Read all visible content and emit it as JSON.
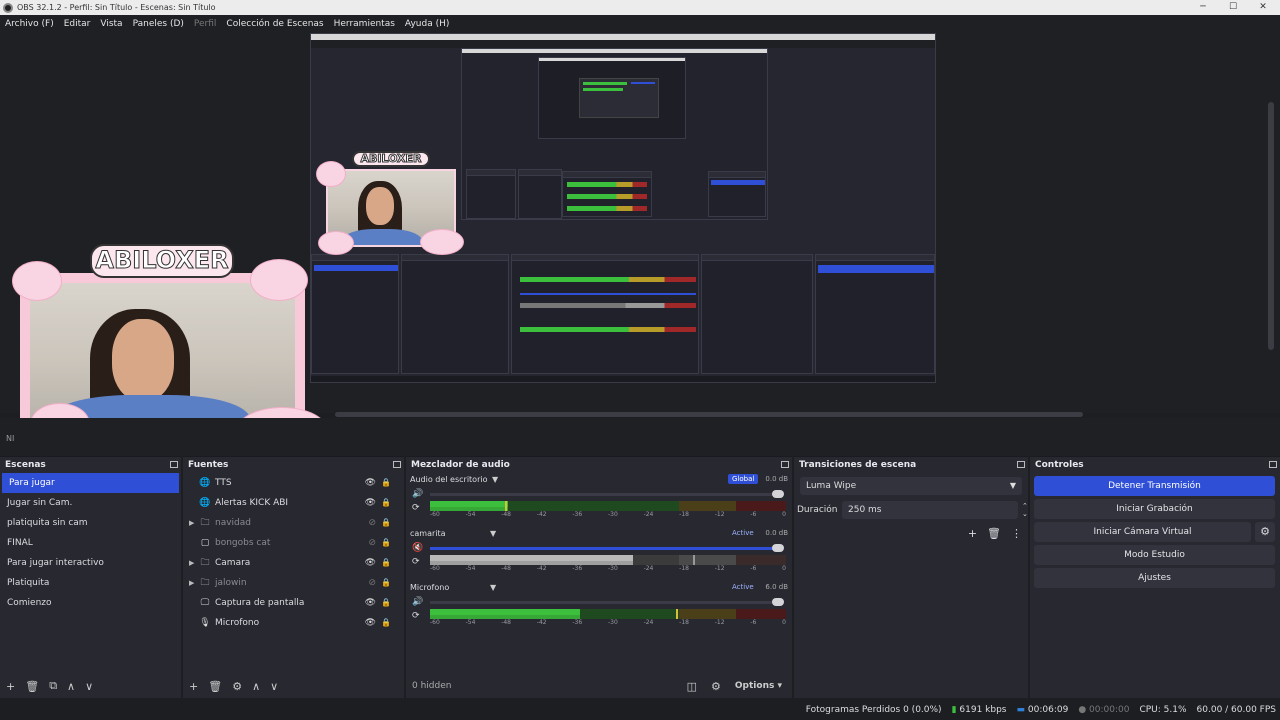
{
  "window": {
    "title": "OBS 32.1.2 - Perfil: Sin Título - Escenas: Sin Título",
    "minimize": "─",
    "maximize": "☐",
    "close": "✕"
  },
  "menu": [
    {
      "label": "Archivo (F)"
    },
    {
      "label": "Editar"
    },
    {
      "label": "Vista"
    },
    {
      "label": "Paneles (D)"
    },
    {
      "label": "Perfil",
      "disabled": true
    },
    {
      "label": "Colección de Escenas"
    },
    {
      "label": "Herramientas"
    },
    {
      "label": "Ayuda (H)"
    }
  ],
  "preview": {
    "overlay_name": "ABILOXER",
    "strip_text": "NI"
  },
  "scenes": {
    "title": "Escenas",
    "items": [
      "Para jugar",
      "Jugar sin Cam.",
      "platiquita sin cam",
      "FINAL",
      "Para jugar interactivo",
      "Platiquita",
      "Comienzo"
    ],
    "selected_index": 0,
    "footer": [
      "+",
      "🗑",
      "⧉",
      "∧",
      "∨"
    ]
  },
  "sources": {
    "title": "Fuentes",
    "items": [
      {
        "name": "TTS",
        "icon": "browser-icon",
        "glyph": "🌐",
        "group": false,
        "visible": true,
        "dim": false
      },
      {
        "name": "Alertas KICK ABI",
        "icon": "browser-icon",
        "glyph": "🌐",
        "group": false,
        "visible": true,
        "dim": false
      },
      {
        "name": "navidad",
        "icon": "folder-icon",
        "glyph": "🗀",
        "group": true,
        "visible": false,
        "dim": true
      },
      {
        "name": "bongobs cat",
        "icon": "image-icon",
        "glyph": "▢",
        "group": false,
        "visible": false,
        "dim": true
      },
      {
        "name": "Camara",
        "icon": "folder-icon",
        "glyph": "🗀",
        "group": true,
        "visible": true,
        "dim": false
      },
      {
        "name": "jalowin",
        "icon": "folder-icon",
        "glyph": "🗀",
        "group": true,
        "visible": false,
        "dim": true
      },
      {
        "name": "Captura de pantalla",
        "icon": "monitor-icon",
        "glyph": "🖵",
        "group": false,
        "visible": true,
        "dim": false
      },
      {
        "name": "Microfono",
        "icon": "microphone-icon",
        "glyph": "🎙",
        "group": false,
        "visible": true,
        "dim": false
      }
    ],
    "footer": [
      "+",
      "🗑",
      "⚙",
      "∧",
      "∨"
    ]
  },
  "mixer": {
    "title": "Mezclador de audio",
    "channels": [
      {
        "name": "Audio del escritorio",
        "tag": "Global",
        "db": "0.0 dB",
        "muted": false,
        "level": 0.22,
        "peak": 0.21,
        "slider": 1.0
      },
      {
        "name": "camarita",
        "tag": "Active",
        "db": "0.0 dB",
        "muted": true,
        "level": 0.57,
        "peak": 0.74,
        "slider": 1.0
      },
      {
        "name": "Microfono",
        "tag": "Active",
        "db": "6.0 dB",
        "muted": false,
        "level": 0.42,
        "peak": 0.69,
        "slider": 1.0
      }
    ],
    "ticks": [
      "-60",
      "-54",
      "-48",
      "-42",
      "-36",
      "-30",
      "-24",
      "-18",
      "-12",
      "-6",
      "0"
    ],
    "footer_hidden": "0 hidden",
    "footer_options": "Options"
  },
  "transitions": {
    "title": "Transiciones de escena",
    "selected": "Luma Wipe",
    "duration_label": "Duración",
    "duration_value": "250 ms"
  },
  "controls": {
    "title": "Controles",
    "stop_stream": "Detener Transmisión",
    "start_recording": "Iniciar Grabación",
    "start_virtual_cam": "Iniciar Cámara Virtual",
    "studio_mode": "Modo Estudio",
    "settings": "Ajustes"
  },
  "status": {
    "dropped": "Fotogramas Perdidos 0 (0.0%)",
    "bitrate": "6191 kbps",
    "stream_time": "00:06:09",
    "rec_time": "00:00:00",
    "cpu": "CPU: 5.1%",
    "fps": "60.00 / 60.00 FPS"
  },
  "colors": {
    "accent": "#2f4fd6",
    "meter_green": "#3cbf3c",
    "meter_yellow": "#b89c2a",
    "meter_red": "#a12828"
  }
}
